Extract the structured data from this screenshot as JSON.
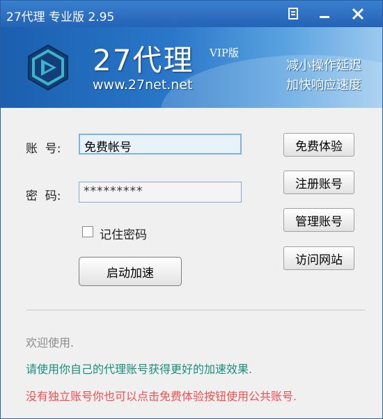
{
  "window": {
    "title": "27代理 专业版 2.95"
  },
  "banner": {
    "brand": "27代理",
    "edition": "VIP版",
    "url": "www.27net.net",
    "slogan_line1": "减小操作延迟",
    "slogan_line2": "加快响应速度"
  },
  "form": {
    "account_label": "账  号:",
    "account_value": "免费帐号",
    "password_label": "密  码:",
    "password_value": "*********",
    "remember_label": "记住密码",
    "remember_checked": false,
    "start_button": "启动加速"
  },
  "side_buttons": [
    "免费体验",
    "注册账号",
    "管理账号",
    "访问网站"
  ],
  "messages": {
    "welcome": "欢迎使用.",
    "tip": "请使用你自己的代理账号获得更好的加速效果.",
    "warning": "没有独立账号你也可以点击免费体验按钮使用公共账号."
  },
  "colors": {
    "welcome": "#8c8c8c",
    "tip": "#1a8f7c",
    "warning": "#f05050",
    "titlebar": "#2b6cc0"
  },
  "icons": [
    "menu-icon",
    "minimize-icon",
    "close-icon",
    "logo-icon"
  ]
}
